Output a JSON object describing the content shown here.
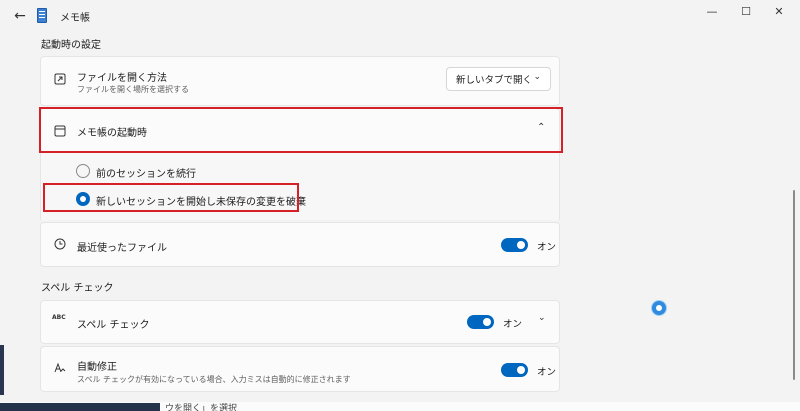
{
  "titlebar": {
    "app_title": "メモ帳",
    "back_icon": "back-arrow-icon",
    "minimize_glyph": "—",
    "maximize_glyph": "☐",
    "close_glyph": "✕"
  },
  "startup_section": {
    "heading": "起動時の設定",
    "open_file": {
      "title": "ファイルを開く方法",
      "subtitle": "ファイルを開く場所を選択する",
      "dropdown_value": "新しいタブで開く"
    },
    "notepad_startup": {
      "title": "メモ帳の起動時",
      "expanded": true,
      "options": [
        {
          "label": "前のセッションを続行",
          "selected": false
        },
        {
          "label": "新しいセッションを開始し未保存の変更を破棄",
          "selected": true
        }
      ]
    },
    "recent_files": {
      "title": "最近使ったファイル",
      "toggle_state": "オン"
    }
  },
  "spell_section": {
    "heading": "スペル チェック",
    "spell_check": {
      "title": "スペル チェック",
      "toggle_state": "オン",
      "icon_text": "ABC"
    },
    "autocorrect": {
      "title": "自動修正",
      "subtitle": "スペル チェックが有効になっている場合、入力ミスは自動的に修正されます",
      "toggle_state": "オン"
    }
  },
  "background_peek_text": "ウを開く」を選択",
  "colors": {
    "accent": "#0067c0",
    "highlight_border": "#d42027",
    "window_bg": "#f3f3f3",
    "card_bg": "#fbfbfb"
  }
}
